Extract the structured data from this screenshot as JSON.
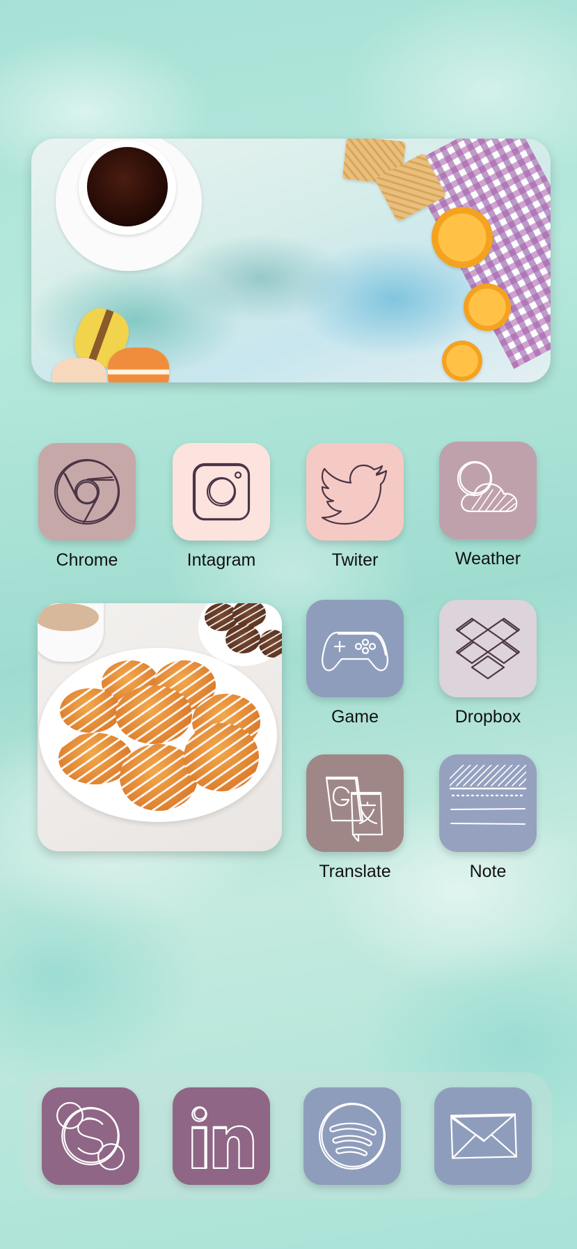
{
  "home_screen": {
    "banner_widget": {
      "image": "coffee-breakfast-photo"
    },
    "photo_widget": {
      "image": "glazed-cookies-photo"
    },
    "apps": [
      {
        "label": "Chrome",
        "icon": "chrome-icon",
        "tile_color": "#c7a8a8"
      },
      {
        "label": "Intagram",
        "icon": "instagram-icon",
        "tile_color": "#fde3de"
      },
      {
        "label": "Twiter",
        "icon": "twitter-icon",
        "tile_color": "#f5cac4"
      },
      {
        "label": "Weather",
        "icon": "weather-icon",
        "tile_color": "#bfa1ac"
      },
      {
        "label": "Game",
        "icon": "gamepad-icon",
        "tile_color": "#8f9dbc"
      },
      {
        "label": "Dropbox",
        "icon": "dropbox-icon",
        "tile_color": "#ddd3da"
      },
      {
        "label": "Translate",
        "icon": "translate-icon",
        "tile_color": "#a08787"
      },
      {
        "label": "Note",
        "icon": "note-icon",
        "tile_color": "#95a1bf"
      }
    ],
    "dock": [
      {
        "icon": "skype-icon",
        "tile_color": "#8f6685"
      },
      {
        "icon": "linkedin-icon",
        "tile_color": "#8f6685"
      },
      {
        "icon": "spotify-icon",
        "tile_color": "#8f9dbc"
      },
      {
        "icon": "mail-icon",
        "tile_color": "#8f9dbc"
      }
    ]
  }
}
